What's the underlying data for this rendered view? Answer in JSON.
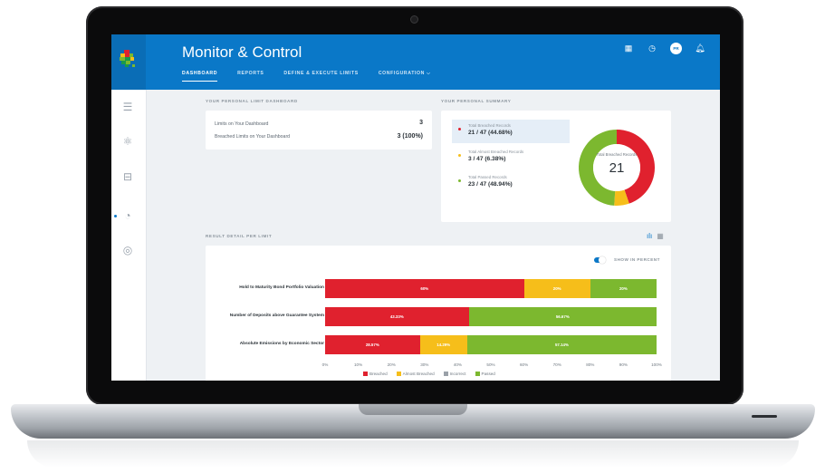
{
  "app": {
    "title": "Monitor & Control"
  },
  "nav": {
    "tabs": [
      {
        "label": "DASHBOARD",
        "active": true
      },
      {
        "label": "REPORTS",
        "active": false
      },
      {
        "label": "DEFINE & EXECUTE LIMITS",
        "active": false
      },
      {
        "label": "CONFIGURATION ⌵",
        "active": false
      }
    ]
  },
  "header_icons": {
    "avatar_initials": "PR",
    "icons": [
      "grid-icon",
      "clock-icon",
      "avatar",
      "bell-icon"
    ]
  },
  "sidebar": {
    "icons": [
      "list-icon",
      "network-icon",
      "limits-icon",
      "gauge-icon",
      "fingerprint-icon"
    ],
    "active_index": 3
  },
  "limit_dashboard": {
    "section_label": "YOUR PERSONAL LIMIT DASHBOARD",
    "rows": [
      {
        "label": "Limits on Your Dashboard",
        "value": "3"
      },
      {
        "label": "Breached Limits on Your Dashboard",
        "value": "3 (100%)"
      }
    ]
  },
  "summary": {
    "section_label": "YOUR PERSONAL SUMMARY",
    "items": [
      {
        "label": "Total Breached Records",
        "value": "21 / 47 (44.68%)",
        "color": "#e0212e",
        "selected": true
      },
      {
        "label": "Total Almost Breached Records",
        "value": "3 / 47 (6.38%)",
        "color": "#f6be1a",
        "selected": false
      },
      {
        "label": "Total Passed Records",
        "value": "23 / 47 (48.94%)",
        "color": "#7cb82f",
        "selected": false
      }
    ],
    "donut": {
      "center_label": "Total Breached Records",
      "center_value": "21",
      "values": [
        21,
        3,
        23
      ],
      "colors": [
        "#e0212e",
        "#f6be1a",
        "#7cb82f"
      ]
    }
  },
  "result_detail": {
    "section_label": "RESULT DETAIL PER LIMIT",
    "toggle_label": "SHOW IN PERCENT",
    "toggle_on": true
  },
  "chart_data": {
    "type": "bar",
    "orientation": "horizontal-stacked",
    "categories": [
      "Hold to Maturity Bond Portfolio Valuation",
      "Number of Deposits above Guarantee System",
      "Absolute Emissions by Economic Sector"
    ],
    "series": [
      {
        "name": "Breached",
        "color": "#e0212e",
        "values": [
          60,
          43.33,
          28.57
        ],
        "labels": [
          "60%",
          "43.33%",
          "28.57%"
        ]
      },
      {
        "name": "Almost Breached",
        "color": "#f6be1a",
        "values": [
          20,
          0,
          14.29
        ],
        "labels": [
          "20%",
          "0%",
          "14.29%"
        ]
      },
      {
        "name": "Incorrect",
        "color": "#9aa1a8",
        "values": [
          0,
          0,
          0
        ],
        "labels": [
          "0%",
          "0%",
          "0%"
        ]
      },
      {
        "name": "Passed",
        "color": "#7cb82f",
        "values": [
          20,
          56.67,
          57.14
        ],
        "labels": [
          "20%",
          "56.67%",
          "57.14%"
        ]
      }
    ],
    "xlim": [
      0,
      100
    ],
    "xticks": [
      "0%",
      "10%",
      "20%",
      "30%",
      "40%",
      "50%",
      "60%",
      "70%",
      "80%",
      "90%",
      "100%"
    ],
    "legend_position": "bottom"
  }
}
